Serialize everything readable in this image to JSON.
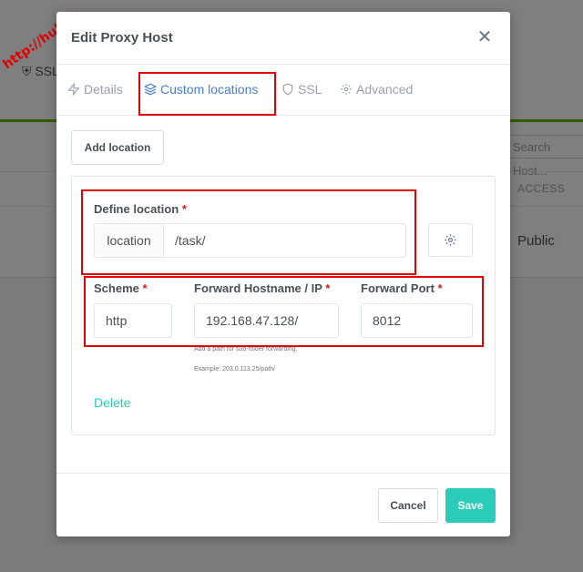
{
  "watermark": "http://hull.kr",
  "background": {
    "tab_ssl": "SSL",
    "search_placeholder": "Search Host...",
    "column_access": "ACCESS",
    "row_access": "Public"
  },
  "modal": {
    "title": "Edit Proxy Host",
    "close_icon": "close-icon",
    "tabs": [
      {
        "label": "Details",
        "icon": "bolt-icon",
        "active": false
      },
      {
        "label": "Custom locations",
        "icon": "layers-icon",
        "active": true
      },
      {
        "label": "SSL",
        "icon": "shield-icon",
        "active": false
      },
      {
        "label": "Advanced",
        "icon": "gear-icon",
        "active": false
      }
    ],
    "add_location_label": "Add location",
    "location": {
      "define_label": "Define location",
      "addon": "location",
      "value": "/task/",
      "settings_icon": "gear-icon",
      "scheme_label": "Scheme",
      "scheme_value": "http",
      "hostname_label": "Forward Hostname / IP",
      "hostname_value": "192.168.47.128/",
      "port_label": "Forward Port",
      "port_value": "8012",
      "hint_line1": "Add a path for sub-folder forwarding.",
      "hint_line2": "Example: 203.0.113.25/path/",
      "delete_label": "Delete",
      "required_mark": "*"
    },
    "cancel_label": "Cancel",
    "save_label": "Save"
  },
  "colors": {
    "accent": "#467fcf",
    "teal": "#2bcbba",
    "required": "#cd201f",
    "highlight": "#e00000",
    "green_bar": "#5eba00"
  }
}
